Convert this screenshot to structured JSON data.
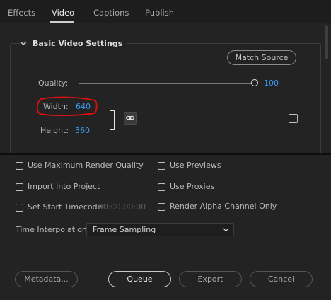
{
  "tabs": [
    "Effects",
    "Video",
    "Captions",
    "Publish"
  ],
  "active_tab": "Video",
  "basic_video": {
    "title": "Basic Video Settings",
    "match_source_label": "Match Source",
    "quality_label": "Quality:",
    "quality_value": "100",
    "width_label": "Width:",
    "width_value": "640",
    "height_label": "Height:",
    "height_value": "360"
  },
  "options": {
    "max_render_quality": "Use Maximum Render Quality",
    "use_previews": "Use Previews",
    "import_into_project": "Import Into Project",
    "use_proxies": "Use Proxies",
    "set_start_timecode": "Set Start Timecode",
    "timecode_value": "00:00:00:00",
    "render_alpha": "Render Alpha Channel Only"
  },
  "time_interpolation": {
    "label": "Time Interpolation:",
    "value": "Frame Sampling"
  },
  "buttons": {
    "metadata": "Metadata...",
    "queue": "Queue",
    "export": "Export",
    "cancel": "Cancel"
  },
  "colors": {
    "background": "#232323",
    "value_blue": "#3d9af0",
    "annotation_red": "#e01010"
  },
  "icons": [
    "chevron-down-icon",
    "link-icon",
    "dropdown-chevron-icon"
  ]
}
